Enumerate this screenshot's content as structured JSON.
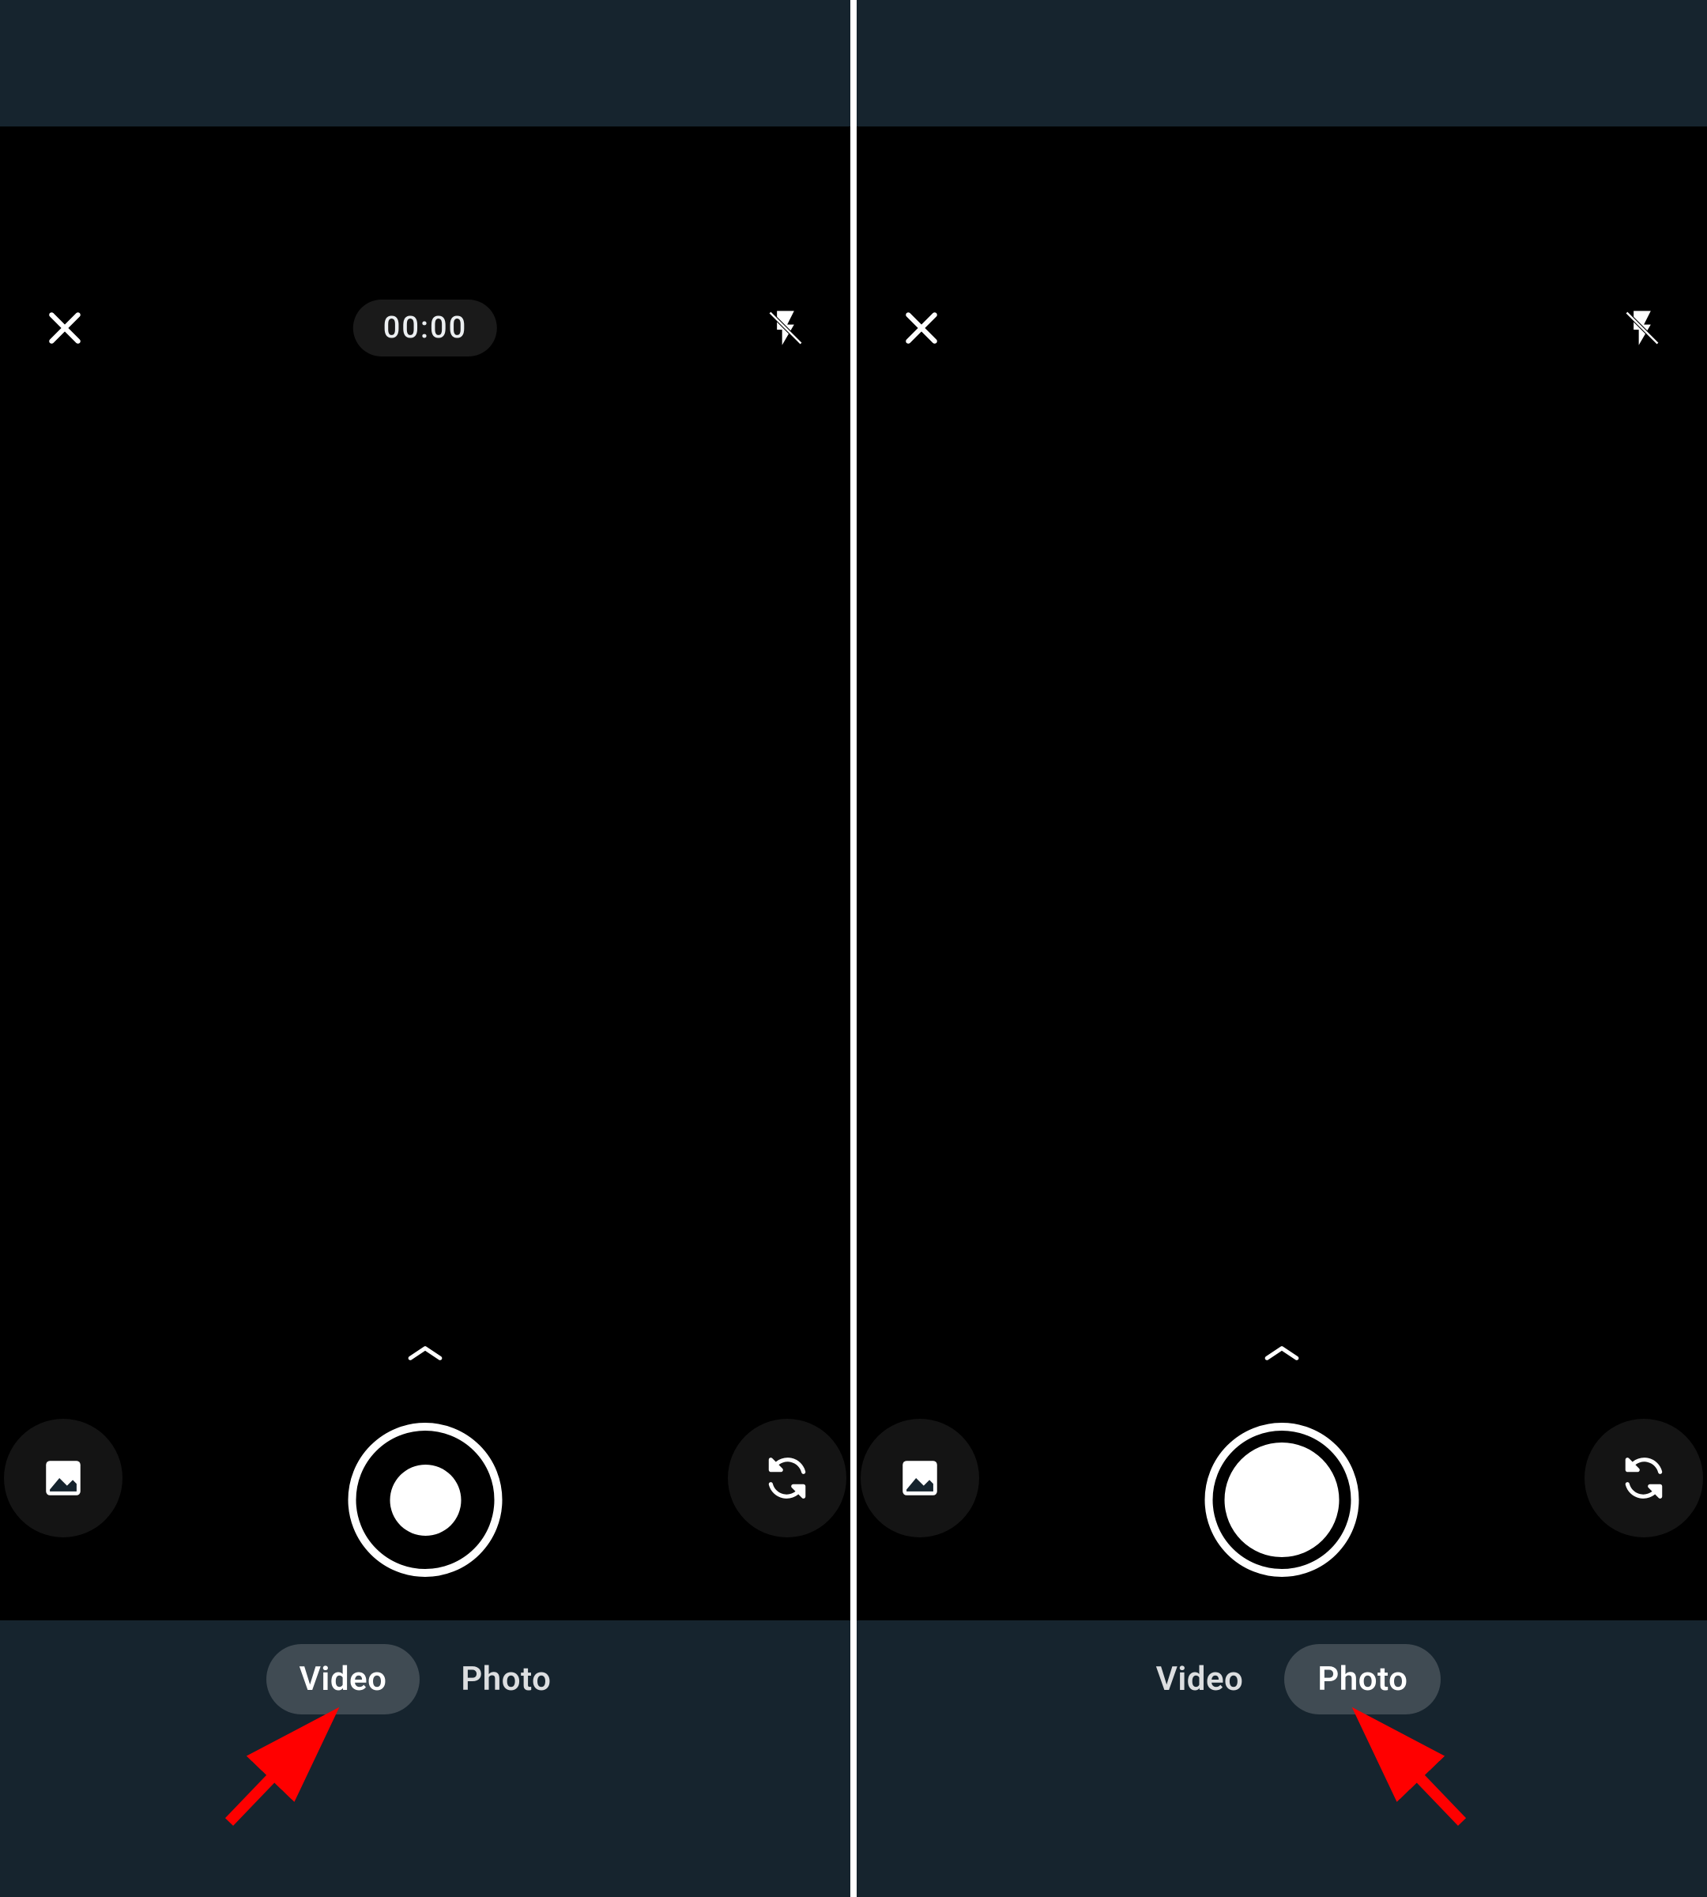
{
  "panes": {
    "left": {
      "timer": "00:00",
      "modes": {
        "video": "Video",
        "photo": "Photo"
      },
      "active_mode": "video"
    },
    "right": {
      "modes": {
        "video": "Video",
        "photo": "Photo"
      },
      "active_mode": "photo"
    }
  },
  "icons": {
    "close": "close-icon",
    "flash_off": "flash-off-icon",
    "gallery": "gallery-icon",
    "switch_camera": "switch-camera-icon",
    "chevron_up": "chevron-up-icon"
  },
  "annotation_color": "#ff0000"
}
